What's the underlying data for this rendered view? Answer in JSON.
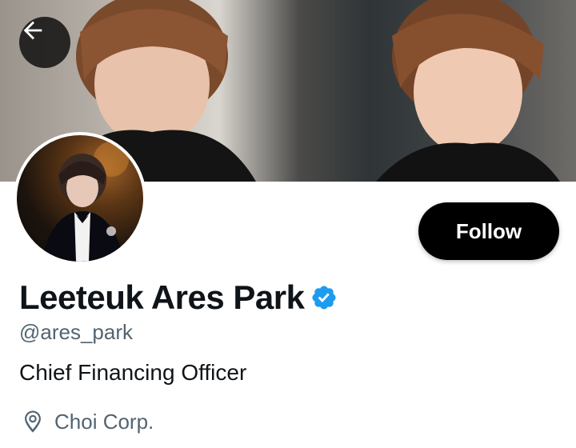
{
  "header": {
    "back_icon": "arrow-left-icon"
  },
  "profile": {
    "display_name": "Leeteuk Ares Park",
    "verified_icon": "verified-badge-icon",
    "handle": "@ares_park",
    "bio": "Chief Financing Officer",
    "location": "Choi Corp.",
    "location_icon": "location-pin-icon"
  },
  "actions": {
    "follow_label": "Follow"
  },
  "colors": {
    "verified_blue": "#1d9bf0",
    "secondary_text": "#536471",
    "primary_text": "#0f1419",
    "follow_bg": "#000000"
  }
}
